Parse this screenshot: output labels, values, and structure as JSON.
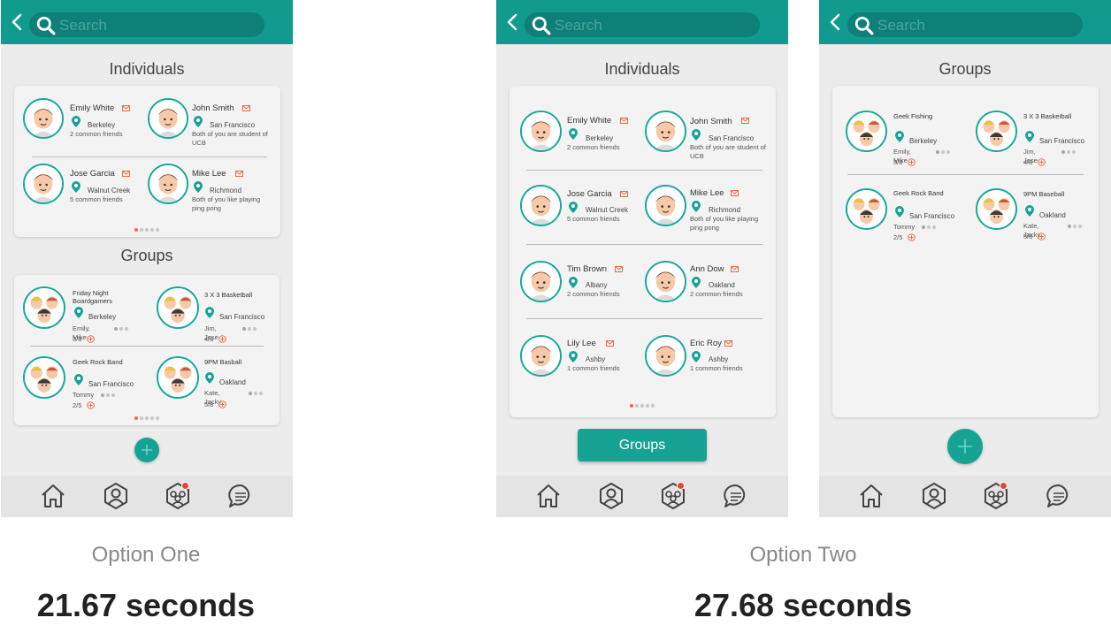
{
  "search_placeholder": "Search",
  "colors": {
    "accent": "#119a8e",
    "orange": "#ef6a42"
  },
  "screen1": {
    "individuals_title": "Individuals",
    "groups_title": "Groups",
    "individuals": [
      {
        "name": "Emily White",
        "loc": "Berkeley",
        "sub": "2 common friends"
      },
      {
        "name": "John Smith",
        "loc": "San Francisco",
        "sub": "Both of you are student of UCB"
      },
      {
        "name": "Jose Garcia",
        "loc": "Walnut Creek",
        "sub": "5 common friends"
      },
      {
        "name": "Mike Lee",
        "loc": "Richmond",
        "sub": "Both of you like playing ping pong"
      }
    ],
    "groups": [
      {
        "name": "Friday Night Boardgamers",
        "loc": "Berkeley",
        "members": "Emily, Mike",
        "count": "3/8"
      },
      {
        "name": "3 X 3 Basketball",
        "loc": "San Francisco",
        "members": "Jim, Jose",
        "count": "4/8"
      },
      {
        "name": "Geek Rock Band",
        "loc": "San Francisco",
        "members": "Tommy",
        "count": "2/5"
      },
      {
        "name": "9PM Basball",
        "loc": "Oakland",
        "members": "Kate, Jacky",
        "count": "5/8"
      }
    ]
  },
  "screen2": {
    "individuals_title": "Individuals",
    "groups_button": "Groups",
    "individuals": [
      {
        "name": "Emily White",
        "loc": "Berkeley",
        "sub": "2 common friends"
      },
      {
        "name": "John Smith",
        "loc": "San Francisco",
        "sub": "Both of you are student of UCB"
      },
      {
        "name": "Jose Garcia",
        "loc": "Walnut Creek",
        "sub": "5 common friends"
      },
      {
        "name": "Mike Lee",
        "loc": "Richmond",
        "sub": "Both of you like playing ping pong"
      },
      {
        "name": "Tim Brown",
        "loc": "Albany",
        "sub": "2 common friends"
      },
      {
        "name": "Ann Dow",
        "loc": "Oakland",
        "sub": "2 common friends"
      },
      {
        "name": "Lily Lee",
        "loc": "Ashby",
        "sub": "1 common friends"
      },
      {
        "name": "Eric Roy",
        "loc": "Ashby",
        "sub": "1 common friends"
      }
    ]
  },
  "screen3": {
    "groups_title": "Groups",
    "groups": [
      {
        "name": "Geek Fishing",
        "loc": "Berkeley",
        "members": "Emily, Mike",
        "count": "3/8"
      },
      {
        "name": "3 X 3 Basketball",
        "loc": "San Francisco",
        "members": "Jim, Jose",
        "count": "4/8"
      },
      {
        "name": "Geek Rock Band",
        "loc": "San Francisco",
        "members": "Tommy",
        "count": "2/5"
      },
      {
        "name": "9PM Baseball",
        "loc": "Oakland",
        "members": "Kate, Jacky",
        "count": "5/8"
      }
    ]
  },
  "captions": {
    "option_one": "Option One",
    "option_two": "Option Two",
    "time_one": "21.67 seconds",
    "time_two": "27.68 seconds"
  }
}
